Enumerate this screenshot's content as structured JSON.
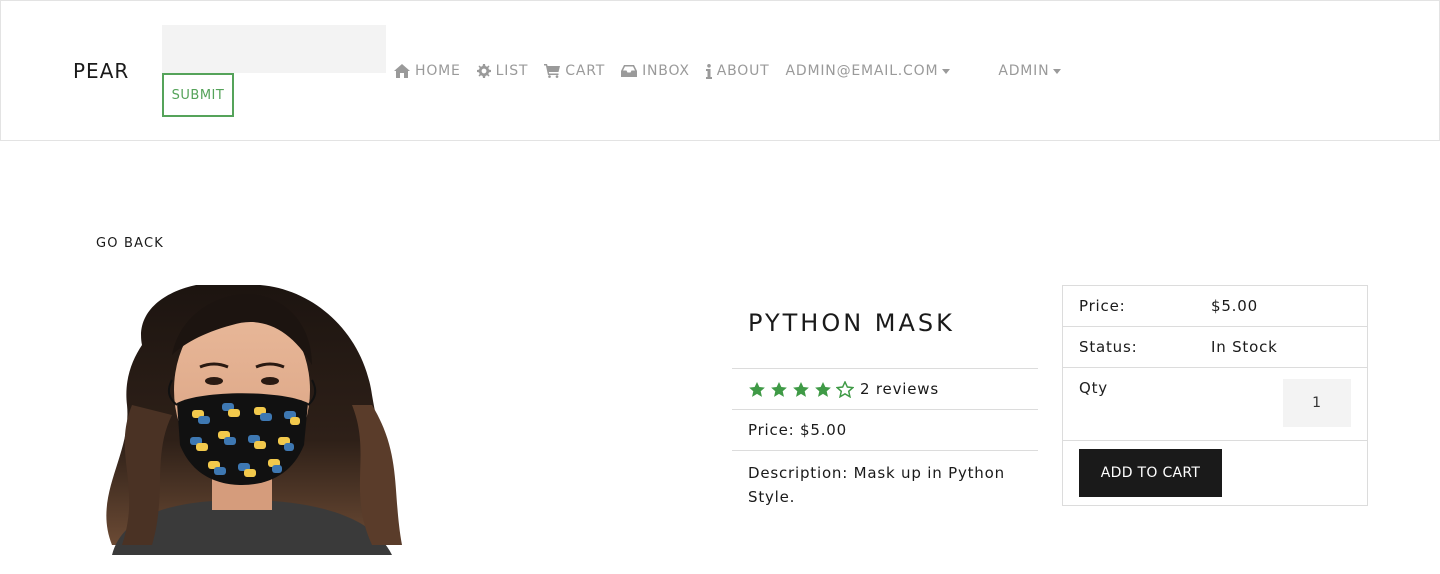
{
  "navbar": {
    "brand": "PEAR",
    "search": {
      "value": "",
      "placeholder": ""
    },
    "submit_label": "SUBMIT",
    "items": [
      {
        "label": "HOME",
        "icon": "home-icon"
      },
      {
        "label": "LIST",
        "icon": "gear-icon"
      },
      {
        "label": "CART",
        "icon": "cart-icon"
      },
      {
        "label": "INBOX",
        "icon": "inbox-icon"
      },
      {
        "label": "ABOUT",
        "icon": "info-icon"
      },
      {
        "label": "ADMIN@EMAIL.COM",
        "icon": "caret-down-icon"
      },
      {
        "label": "ADMIN",
        "icon": "caret-down-icon"
      }
    ]
  },
  "page": {
    "go_back": "GO BACK"
  },
  "product": {
    "name": "PYTHON MASK",
    "rating": 4,
    "rating_max": 5,
    "reviews": "2 reviews",
    "price_line": "Price: $5.00",
    "description": "Description: Mask up in Python Style."
  },
  "purchase_card": {
    "price_label": "Price:",
    "price_value": "$5.00",
    "status_label": "Status:",
    "status_value": "In Stock",
    "qty_label": "Qty",
    "qty_value": "1",
    "add_to_cart": "ADD TO CART"
  },
  "colors": {
    "accent_green": "#55a35a",
    "star_green": "#3f9a46",
    "button_dark": "#1a1a1a",
    "nav_gray": "#9a9a9a"
  }
}
